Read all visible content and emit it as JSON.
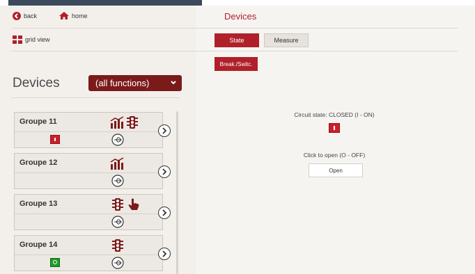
{
  "nav": {
    "back_label": "back",
    "home_label": "home",
    "gridview_label": "grid view"
  },
  "left": {
    "title": "Devices",
    "filter_value": "(all functions)"
  },
  "groups": [
    {
      "name": "Groupe  11",
      "icons": [
        "chart-bars-icon",
        "traffic-light-icon"
      ],
      "state": "red"
    },
    {
      "name": "Groupe  12",
      "icons": [
        "chart-bars-icon"
      ],
      "state": "none"
    },
    {
      "name": "Groupe  13",
      "icons": [
        "traffic-light-icon",
        "hand-pointer-icon"
      ],
      "state": "none"
    },
    {
      "name": "Groupe  14",
      "icons": [
        "traffic-light-icon"
      ],
      "state": "green"
    }
  ],
  "right": {
    "title": "Devices",
    "tabs": [
      {
        "label": "State",
        "active": true
      },
      {
        "label": "Measure",
        "active": false
      }
    ],
    "break_button": "Break./Switc.",
    "circuit_state": "Circuit state: CLOSED (I - ON)",
    "click_text": "Click to open (O - OFF)",
    "open_button": "Open"
  },
  "colors": {
    "accent": "#b0202a",
    "select_bg": "#7b1a1a",
    "state_on": "#cc1f2a",
    "state_off": "#1f9a2a"
  }
}
